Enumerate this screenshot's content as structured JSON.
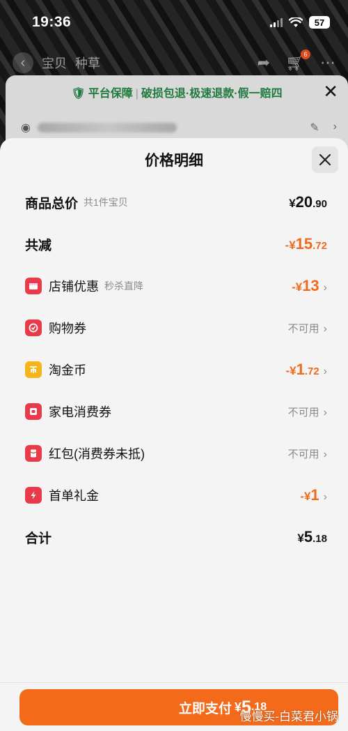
{
  "status_bar": {
    "time": "19:36",
    "battery": "57"
  },
  "top_nav": {
    "tabs": [
      "宝贝",
      "种草"
    ],
    "cart_count": "6"
  },
  "guarantee": {
    "brand": "平台保障",
    "items": "破损包退·极速退款·假一赔四"
  },
  "sheet": {
    "title": "价格明细",
    "total": {
      "label": "商品总价",
      "sub": "共1件宝贝",
      "yen": "¥",
      "int": "20",
      "dec": ".90"
    },
    "discount": {
      "label": "共减",
      "yen": "-¥",
      "int": "15",
      "dec": ".72"
    },
    "items": [
      {
        "label": "店铺优惠",
        "sub": "秒杀直降",
        "icon": "store-coupon-icon",
        "icon_color": "#e83a4a",
        "value_yen": "-¥",
        "value_int": "13",
        "value_dec": "",
        "status": ""
      },
      {
        "label": "购物券",
        "sub": "",
        "icon": "shopping-coupon-icon",
        "icon_color": "#e83a4a",
        "value_yen": "",
        "value_int": "",
        "value_dec": "",
        "status": "不可用"
      },
      {
        "label": "淘金币",
        "sub": "",
        "icon": "gold-coin-icon",
        "icon_color": "#f5b41a",
        "value_yen": "-¥",
        "value_int": "1",
        "value_dec": ".72",
        "status": ""
      },
      {
        "label": "家电消费券",
        "sub": "",
        "icon": "appliance-coupon-icon",
        "icon_color": "#e83a4a",
        "value_yen": "",
        "value_int": "",
        "value_dec": "",
        "status": "不可用"
      },
      {
        "label": "红包(消费券未抵)",
        "sub": "",
        "icon": "red-packet-icon",
        "icon_color": "#e83a4a",
        "value_yen": "",
        "value_int": "",
        "value_dec": "",
        "status": "不可用"
      },
      {
        "label": "首单礼金",
        "sub": "",
        "icon": "first-order-gift-icon",
        "icon_color": "#e83a4a",
        "value_yen": "-¥",
        "value_int": "1",
        "value_dec": "",
        "status": ""
      }
    ],
    "sum": {
      "label": "合计",
      "yen": "¥",
      "int": "5",
      "dec": ".18"
    }
  },
  "pay_button": {
    "label": "立即支付",
    "yen": "¥",
    "int": "5",
    "dec": ".18"
  },
  "watermark": "慢慢买-白菜君小锅",
  "colors": {
    "accent_orange": "#f36a1b",
    "discount_orange": "#f06a1c",
    "guarantee_green": "#1f7a3e",
    "icon_red": "#e83a4a",
    "icon_gold": "#f5b41a"
  }
}
